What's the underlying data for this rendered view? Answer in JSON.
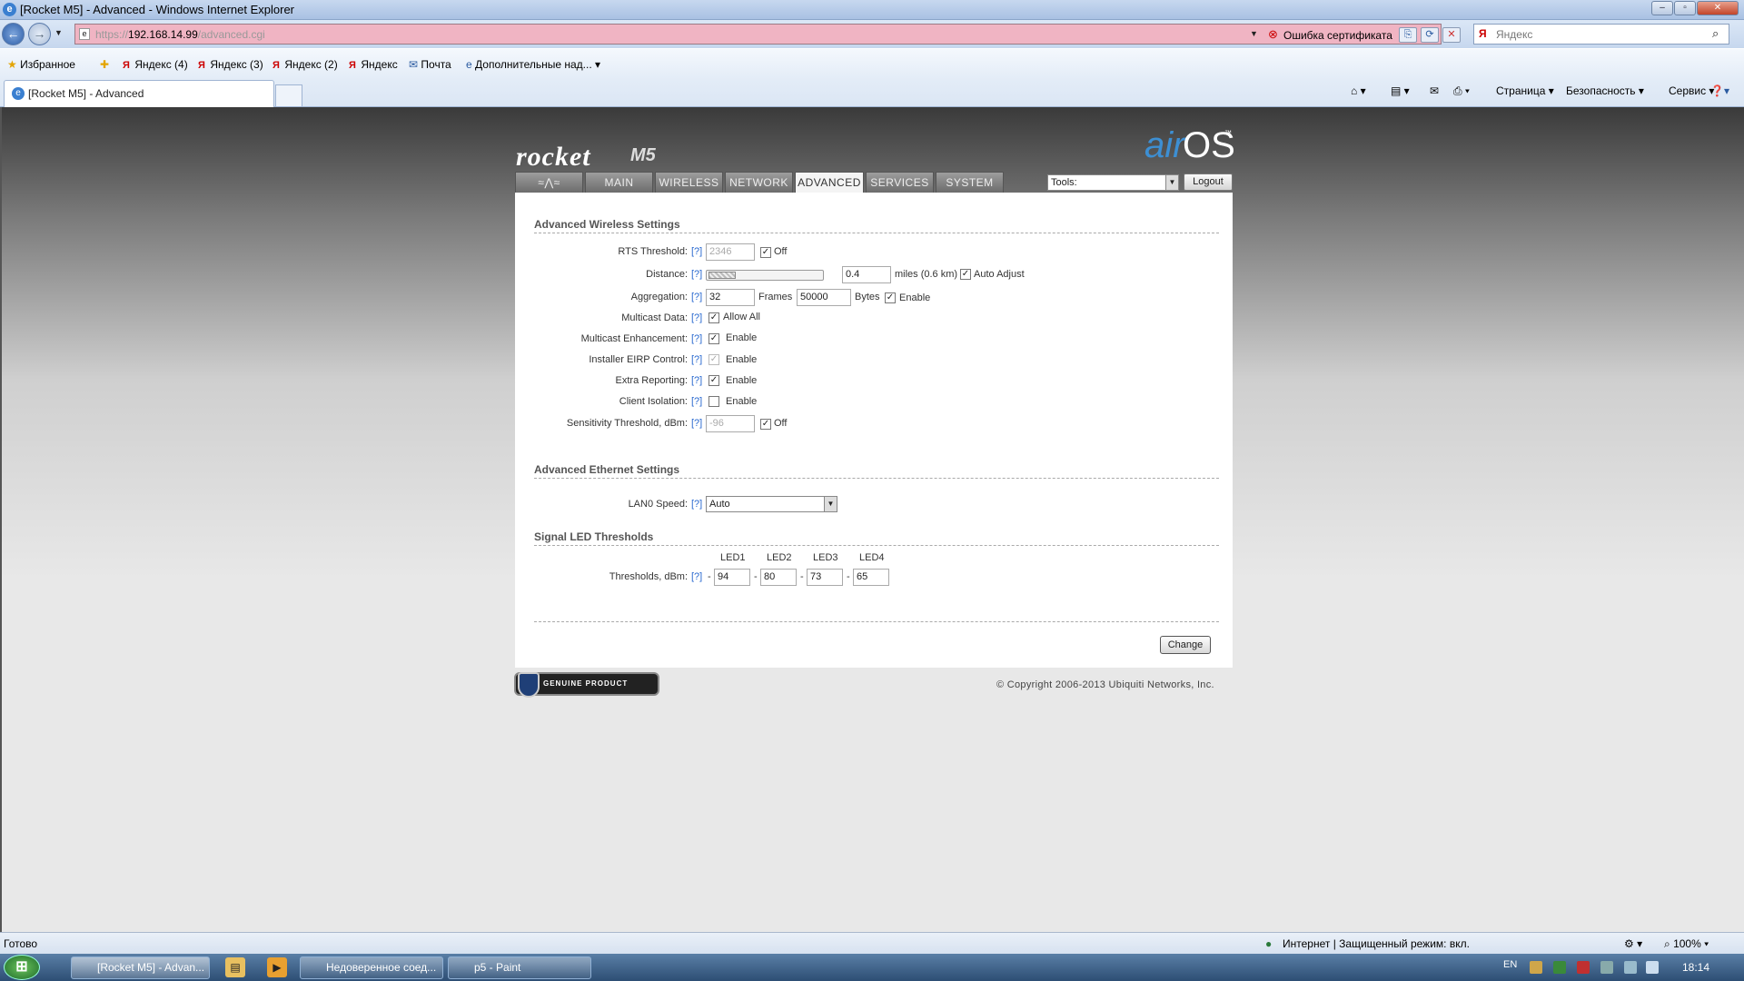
{
  "window": {
    "title": "[Rocket M5] - Advanced - Windows Internet Explorer"
  },
  "address": {
    "host": "192.168.14.99",
    "scheme": "https://",
    "path": "/advanced.cgi",
    "cert_error": "Ошибка сертификата"
  },
  "search": {
    "placeholder": "Яндекс"
  },
  "favorites": {
    "label": "Избранное",
    "items": [
      "Яндекс (4)",
      "Яндекс (3)",
      "Яндекс (2)",
      "Яндекс",
      "Почта",
      "Дополнительные над..."
    ]
  },
  "tab": {
    "title": "[Rocket M5] - Advanced"
  },
  "commandbar": {
    "page": "Страница",
    "security": "Безопасность",
    "service": "Сервис"
  },
  "brand": {
    "product": "rocket",
    "model": "M5",
    "os_air": "air",
    "os_os": "OS",
    "tm": "™"
  },
  "nav": {
    "tabs": [
      "MAIN",
      "WIRELESS",
      "NETWORK",
      "ADVANCED",
      "SERVICES",
      "SYSTEM"
    ],
    "active": "ADVANCED"
  },
  "tools": {
    "value": "Tools:",
    "logout": "Logout"
  },
  "wireless": {
    "heading": "Advanced Wireless Settings",
    "help": "[?]",
    "rts_label": "RTS Threshold:",
    "rts_value": "2346",
    "rts_off": "Off",
    "distance_label": "Distance:",
    "distance_value": "0.4",
    "distance_unit": "miles (0.6 km)",
    "auto_adjust": "Auto Adjust",
    "aggregation_label": "Aggregation:",
    "agg_frames": "32",
    "frames": "Frames",
    "agg_bytes": "50000",
    "bytes": "Bytes",
    "enable": "Enable",
    "multicast_label": "Multicast Data:",
    "allow_all": "Allow All",
    "mcast_enh_label": "Multicast Enhancement:",
    "eirp_label": "Installer EIRP Control:",
    "extra_label": "Extra Reporting:",
    "isolation_label": "Client Isolation:",
    "sens_label": "Sensitivity Threshold, dBm:",
    "sens_value": "-96",
    "sens_off": "Off"
  },
  "ethernet": {
    "heading": "Advanced Ethernet Settings",
    "lan_label": "LAN0 Speed:",
    "lan_value": "Auto"
  },
  "led": {
    "heading": "Signal LED Thresholds",
    "cols": [
      "LED1",
      "LED2",
      "LED3",
      "LED4"
    ],
    "label": "Thresholds, dBm:",
    "values": [
      "94",
      "80",
      "73",
      "65"
    ],
    "dash": "-"
  },
  "buttons": {
    "change": "Change"
  },
  "footer": {
    "genuine": "GENUINE PRODUCT",
    "copyright": "© Copyright 2006-2013 Ubiquiti Networks, Inc."
  },
  "status": {
    "left": "Готово",
    "zone": "Интернет | Защищенный режим: вкл.",
    "zoom": "100%"
  },
  "taskbar": {
    "tasks": [
      "[Rocket M5] - Advan...",
      "Недоверенное соед...",
      "p5 - Paint"
    ],
    "lang": "EN",
    "time": "18:14"
  },
  "colors": {
    "accent": "#2a6ad0",
    "address_error": "#f0b4c3"
  }
}
